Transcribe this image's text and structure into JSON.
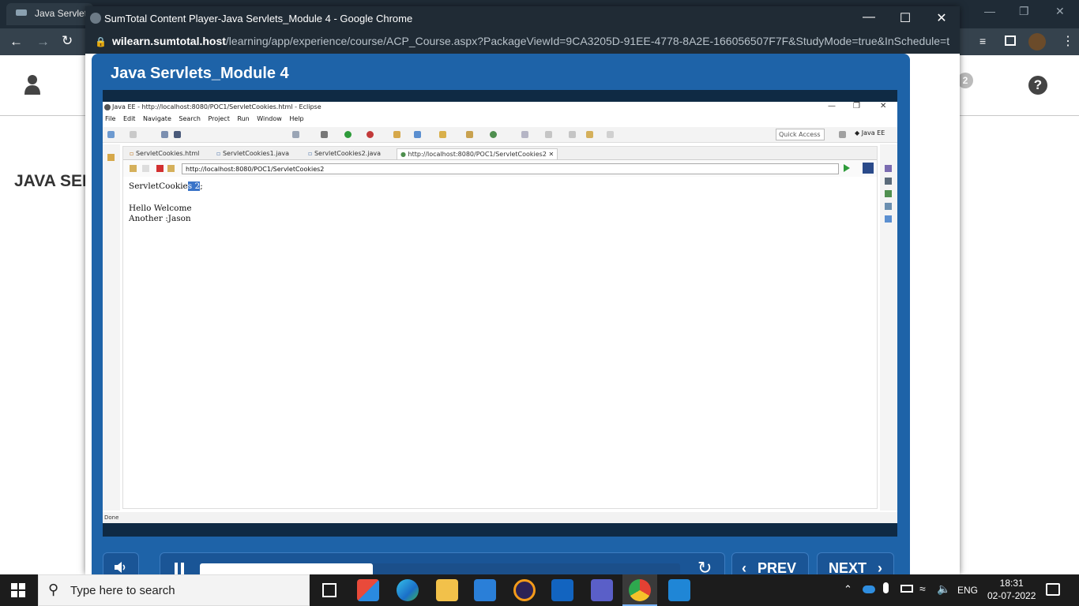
{
  "bg_window": {
    "tab_title": "Java Servlets",
    "heading": "JAVA SER",
    "badge_count": "2",
    "help_symbol": "?"
  },
  "popup": {
    "title": "SumTotal Content Player-Java Servlets_Module 4 - Google Chrome",
    "url_host": "wilearn.sumtotal.host",
    "url_path": "/learning/app/experience/course/ACP_Course.aspx?PackageViewId=9CA3205D-91EE-4778-8A2E-166056507F7F&StudyMode=true&InSchedule=tru..."
  },
  "player": {
    "title": "Java Servlets_Module 4",
    "prev_label": "PREV",
    "next_label": "NEXT",
    "progress": 0.36
  },
  "eclipse": {
    "title": "Java EE - http://localhost:8080/POC1/ServletCookies.html - Eclipse",
    "menu": [
      "File",
      "Edit",
      "Navigate",
      "Search",
      "Project",
      "Run",
      "Window",
      "Help"
    ],
    "quick_access": "Quick Access",
    "perspective": "Java EE",
    "tabs": [
      "ServletCookies.html",
      "ServletCookies1.java",
      "ServletCookies2.java",
      "http://localhost:8080/POC1/ServletCookies2"
    ],
    "browser_url": "http://localhost:8080/POC1/ServletCookies2",
    "content": {
      "line1_prefix": "ServletCookie",
      "line1_selected": "s 2",
      "line1_suffix": ";",
      "line2": "Hello Welcome",
      "line3": "Another :Jason"
    },
    "status": "Done"
  },
  "taskbar": {
    "search_placeholder": "Type here to search",
    "lang": "ENG",
    "time": "18:31",
    "date": "02-07-2022"
  }
}
